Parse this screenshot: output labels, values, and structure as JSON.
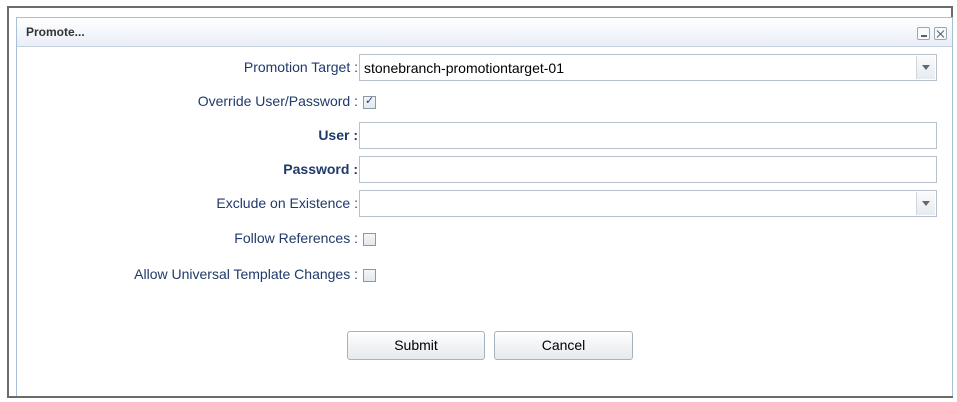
{
  "dialog": {
    "title": "Promote...",
    "minimize_icon": "minimize-icon",
    "close_icon": "close-icon"
  },
  "form": {
    "promotion_target": {
      "label": "Promotion Target :",
      "value": "stonebranch-promotiontarget-01"
    },
    "override_user_password": {
      "label": "Override User/Password :",
      "checked": true
    },
    "user": {
      "label": "User :",
      "value": ""
    },
    "password": {
      "label": "Password :",
      "value": ""
    },
    "exclude_on_existence": {
      "label": "Exclude on Existence :",
      "value": ""
    },
    "follow_references": {
      "label": "Follow References :",
      "checked": false
    },
    "allow_universal_template_changes": {
      "label": "Allow Universal Template Changes :",
      "checked": false
    }
  },
  "buttons": {
    "submit": "Submit",
    "cancel": "Cancel"
  }
}
